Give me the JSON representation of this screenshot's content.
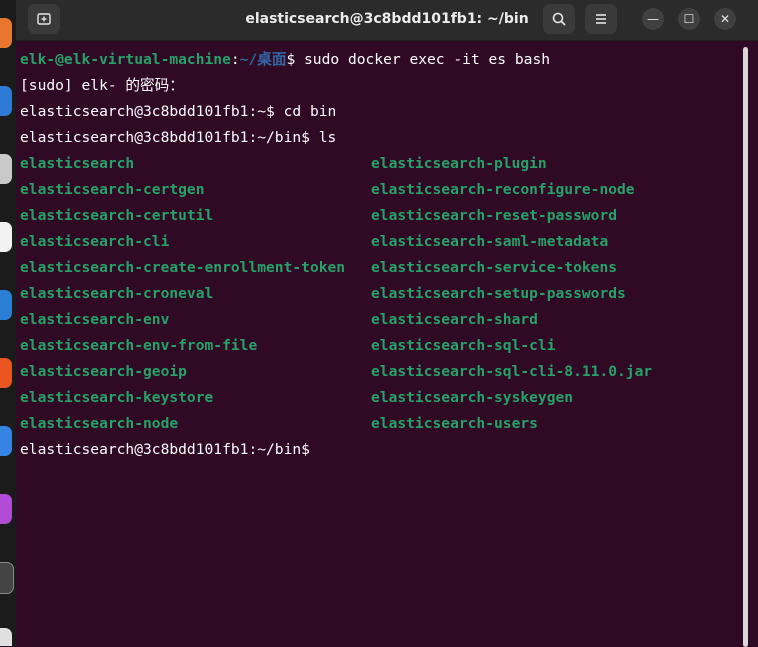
{
  "window": {
    "title": "elasticsearch@3c8bdd101fb1: ~/bin",
    "new_tab_icon": "new-tab-icon",
    "search_icon": "search-icon",
    "menu_icon": "hamburger-menu-icon",
    "minimize_glyph": "—",
    "maximize_glyph": "☐",
    "close_glyph": "✕"
  },
  "terminal": {
    "prompt1": {
      "user_host": "elk-@elk-virtual-machine",
      "sep": ":",
      "path": "~/桌面",
      "dollar": "$ ",
      "command": "sudo docker exec -it es bash"
    },
    "sudo_prompt": "[sudo] elk- 的密码：",
    "prompt2": "elasticsearch@3c8bdd101fb1:~$ cd bin",
    "prompt3": "elasticsearch@3c8bdd101fb1:~/bin$ ls",
    "ls_col1": [
      "elasticsearch",
      "elasticsearch-certgen",
      "elasticsearch-certutil",
      "elasticsearch-cli",
      "elasticsearch-create-enrollment-token",
      "elasticsearch-croneval",
      "elasticsearch-env",
      "elasticsearch-env-from-file",
      "elasticsearch-geoip",
      "elasticsearch-keystore",
      "elasticsearch-node"
    ],
    "ls_col2": [
      "elasticsearch-plugin",
      "elasticsearch-reconfigure-node",
      "elasticsearch-reset-password",
      "elasticsearch-saml-metadata",
      "elasticsearch-service-tokens",
      "elasticsearch-setup-passwords",
      "elasticsearch-shard",
      "elasticsearch-sql-cli",
      "elasticsearch-sql-cli-8.11.0.jar",
      "elasticsearch-syskeygen",
      "elasticsearch-users"
    ],
    "final_prompt": "elasticsearch@3c8bdd101fb1:~/bin$"
  },
  "colors": {
    "background": "#300a24",
    "prompt_green": "#26a269",
    "path_blue": "#3465a4",
    "text": "#ffffff"
  }
}
